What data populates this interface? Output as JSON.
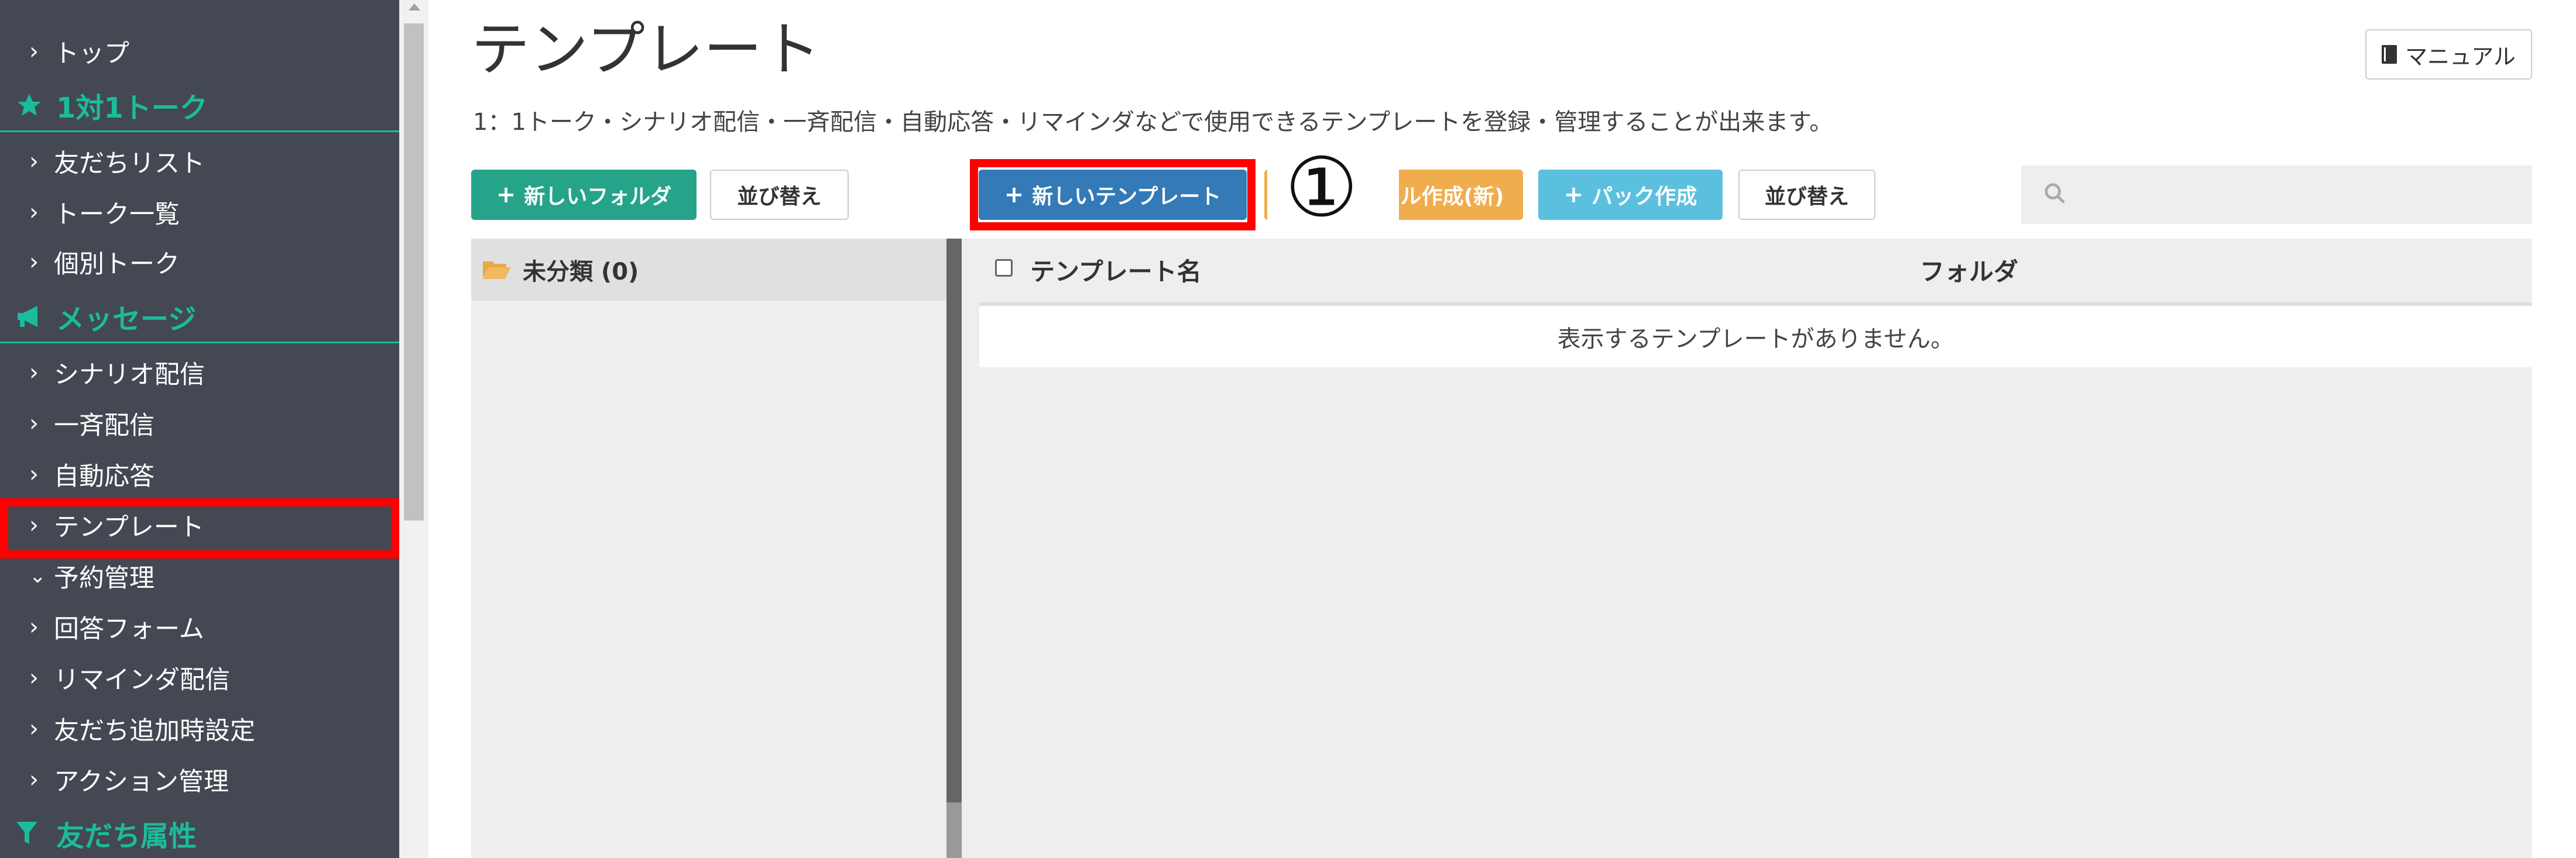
{
  "sidebar": {
    "items": [
      {
        "type": "item",
        "label": "トップ"
      },
      {
        "type": "section",
        "label": "1対1トーク",
        "icon": "star-icon"
      },
      {
        "type": "item",
        "label": "友だちリスト"
      },
      {
        "type": "item",
        "label": "トーク一覧"
      },
      {
        "type": "item",
        "label": "個別トーク"
      },
      {
        "type": "section",
        "label": "メッセージ",
        "icon": "megaphone-icon"
      },
      {
        "type": "item",
        "label": "シナリオ配信"
      },
      {
        "type": "item",
        "label": "一斉配信"
      },
      {
        "type": "item",
        "label": "自動応答"
      },
      {
        "type": "item",
        "label": "テンプレート",
        "active": true
      },
      {
        "type": "item",
        "label": "予約管理",
        "expanded": true
      },
      {
        "type": "item",
        "label": "回答フォーム"
      },
      {
        "type": "item",
        "label": "リマインダ配信"
      },
      {
        "type": "item",
        "label": "友だち追加時設定"
      },
      {
        "type": "item",
        "label": "アクション管理"
      },
      {
        "type": "section",
        "label": "友だち属性",
        "icon": "filter-icon"
      }
    ],
    "accent_color": "#1bbc9b",
    "background_color": "#434852"
  },
  "header": {
    "title": "テンプレート",
    "description": "1：1トーク・シナリオ配信・一斉配信・自動応答・リマインダなどで使用できるテンプレートを登録・管理することが出来ます。",
    "manual_label": "マニュアル"
  },
  "toolbar": {
    "new_folder": "新しいフォルダ",
    "sort_folders": "並び替え",
    "new_template": "新しいテンプレート",
    "carousel_new": "ル作成(新)",
    "pack_create": "パック作成",
    "sort_templates": "並び替え",
    "search_placeholder": ""
  },
  "folders": [
    {
      "label": "未分類 (0)"
    }
  ],
  "table": {
    "columns": [
      "テンプレート名",
      "フォルダ"
    ],
    "empty_message": "表示するテンプレートがありません。"
  },
  "annotation": {
    "marker": "①",
    "highlight_color": "#ff0000"
  },
  "colors": {
    "green": "#26a48a",
    "blue": "#337ab7",
    "orange": "#f0ad4e",
    "cyan": "#5bc0de"
  }
}
